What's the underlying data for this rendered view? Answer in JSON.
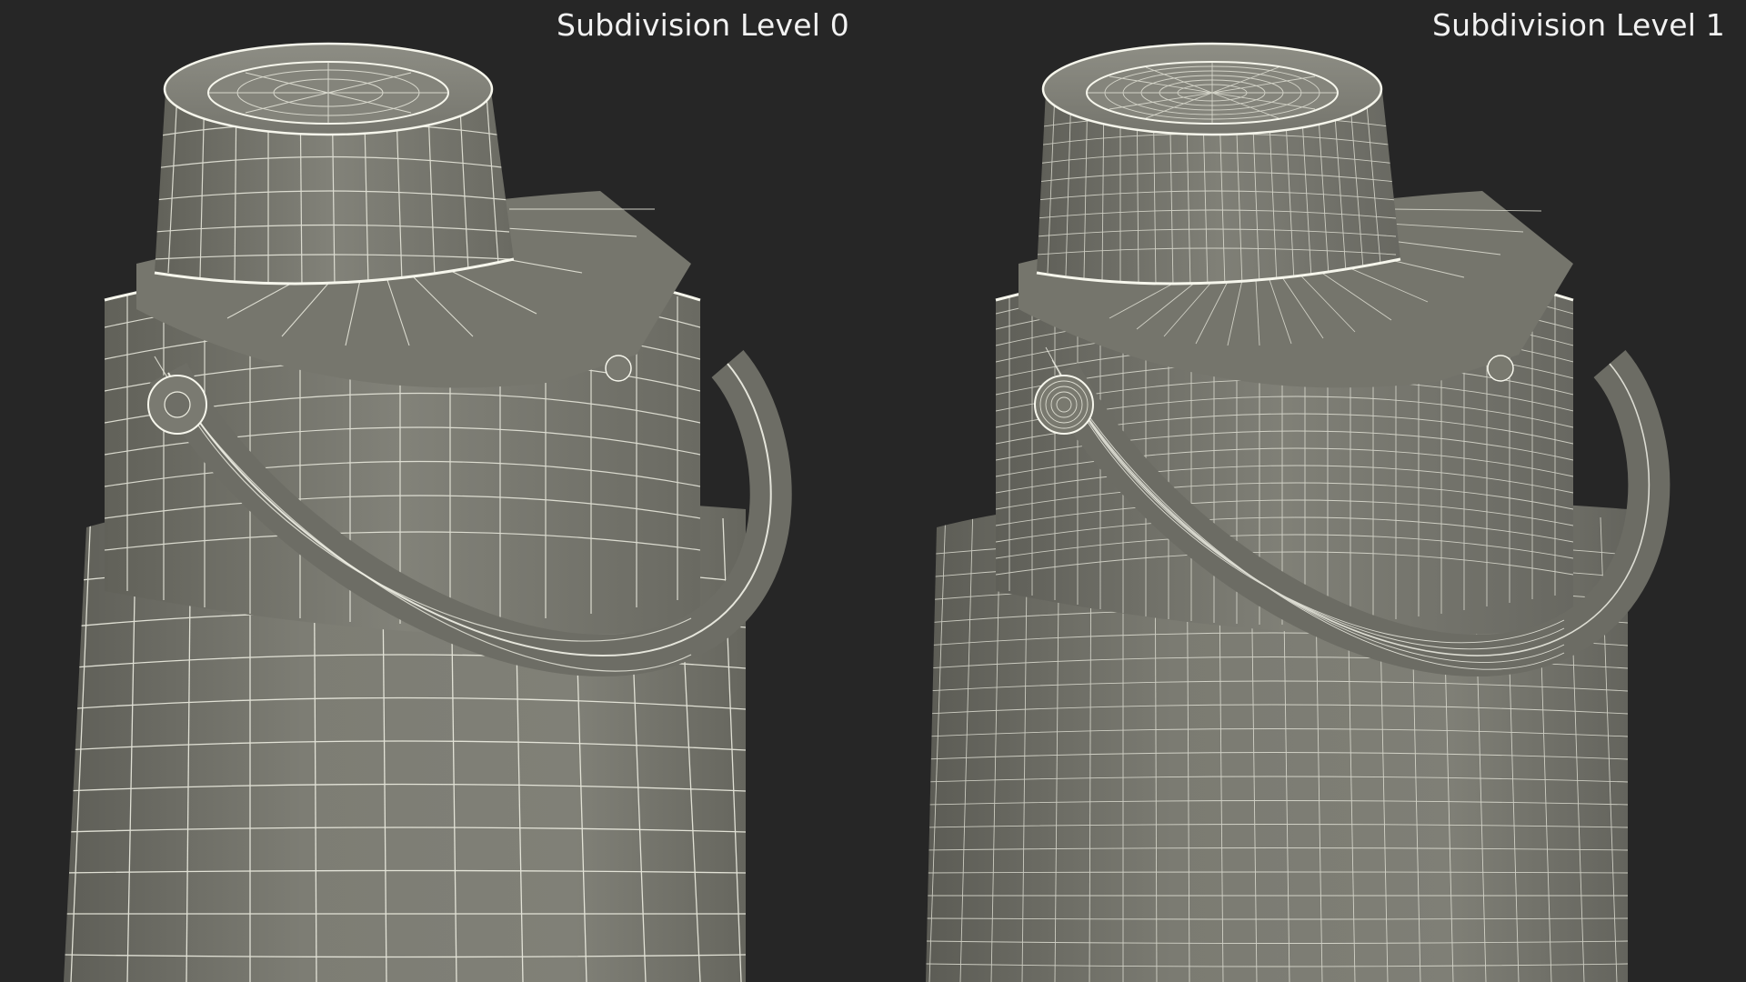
{
  "panels": [
    {
      "caption": "Subdivision Level 0",
      "subdivision_level": 0
    },
    {
      "caption": "Subdivision Level 1",
      "subdivision_level": 1
    }
  ],
  "colors": {
    "background": "#262626",
    "surface": "#7b7b72",
    "surface_dark": "#5d5d56",
    "wire": "#f4f4ea",
    "caption": "#f2f2f2"
  }
}
